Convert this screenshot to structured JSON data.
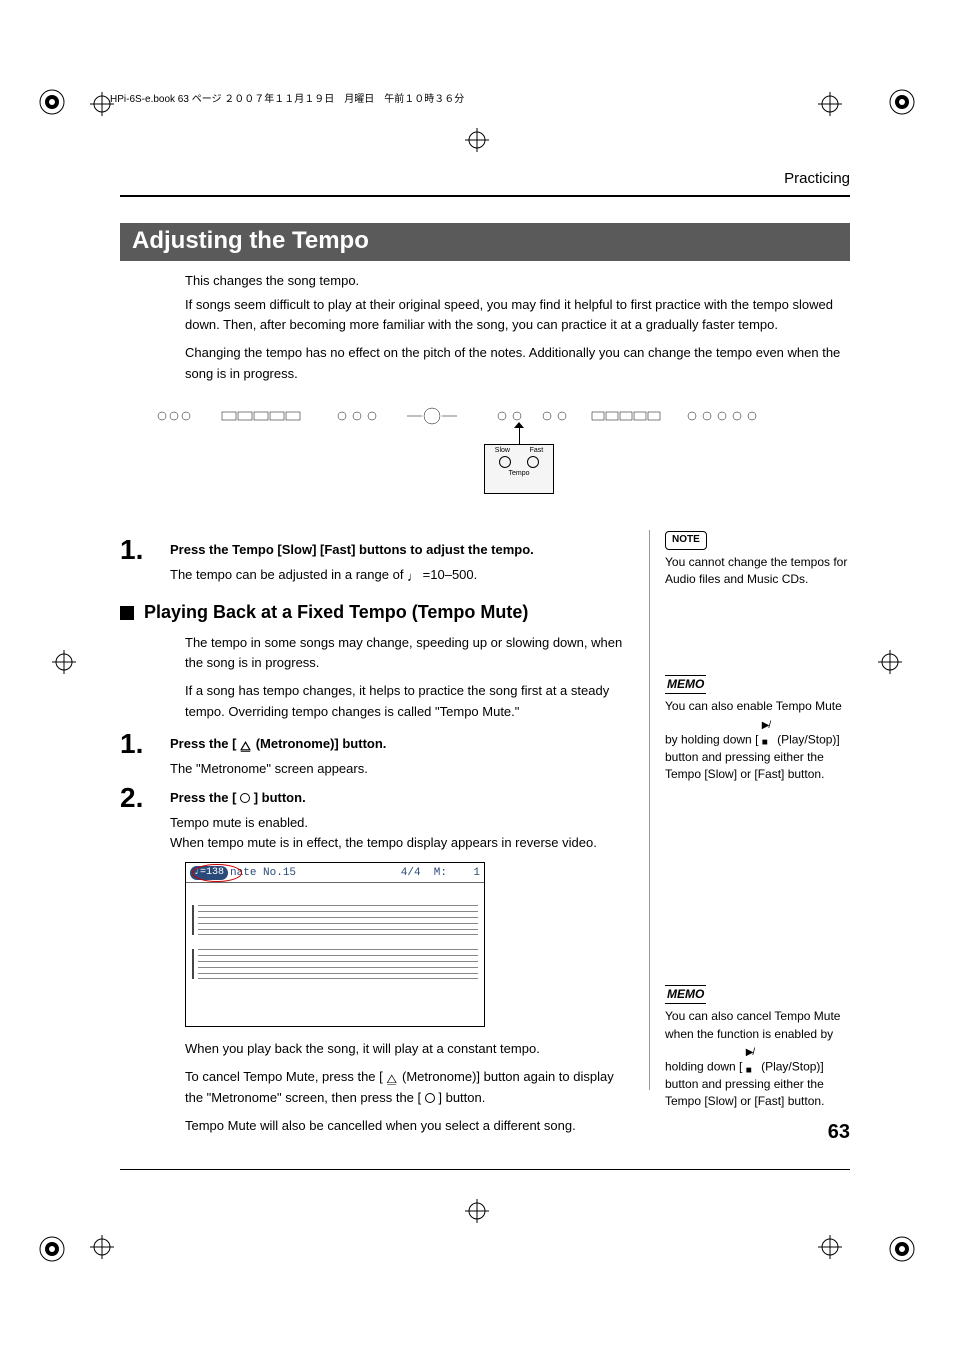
{
  "header_line": "HPi-6S-e.book  63 ページ  ２００７年１１月１９日　月曜日　午前１０時３６分",
  "section": "Practicing",
  "title": "Adjusting the Tempo",
  "intro": {
    "p1": "This changes the song tempo.",
    "p2": "If songs seem difficult to play at their original speed, you may find it helpful to first practice with the tempo slowed down. Then, after becoming more familiar with the song, you can practice it at a gradually faster tempo.",
    "p3": "Changing the tempo has no effect on the pitch of the notes. Additionally you can change the tempo even when the song is in progress."
  },
  "panel": {
    "callout_left": "Slow",
    "callout_right": "Fast",
    "callout_bottom": "Tempo"
  },
  "step1": {
    "num": "1.",
    "title": "Press the Tempo [Slow] [Fast] buttons to adjust the tempo.",
    "body_pre": "The tempo can be adjusted in a range of ",
    "body_post": " =10–500."
  },
  "sub_heading": "Playing Back at a Fixed Tempo (Tempo Mute)",
  "sub_intro": {
    "p1": "The tempo in some songs may change, speeding up or slowing down, when the song is in progress.",
    "p2": "If a song has tempo changes, it helps to practice the song first at a steady tempo. Overriding tempo changes is called \"Tempo Mute.\""
  },
  "sub_step1": {
    "num": "1.",
    "title_pre": "Press the [ ",
    "title_post": " (Metronome)] button.",
    "body": "The \"Metronome\" screen appears."
  },
  "sub_step2": {
    "num": "2.",
    "title_pre": "Press the [ ",
    "title_post": " ] button.",
    "body1": "Tempo mute is enabled.",
    "body2": "When tempo mute is in effect, the tempo display appears in reverse video."
  },
  "screen": {
    "tempo": "♩=138",
    "song": "nate No.15",
    "time_sig": "4/4",
    "measure_label": "M:",
    "measure": "1"
  },
  "after_screen": {
    "p1": "When you play back the song, it will play at a constant tempo.",
    "p2_pre": "To cancel Tempo Mute, press the [ ",
    "p2_mid": " (Metronome)] button again to display the \"Metronome\" screen, then press the [ ",
    "p2_post": " ] button.",
    "p3": "Tempo Mute will also be cancelled when you select a different song."
  },
  "note": {
    "badge": "NOTE",
    "text": "You cannot change the tempos for Audio files and Music CDs."
  },
  "memo1": {
    "badge": "MEMO",
    "text_pre": "You can also enable Tempo Mute by holding down [ ",
    "text_post": " (Play/Stop)] button and pressing either the Tempo [Slow] or [Fast] button."
  },
  "memo2": {
    "badge": "MEMO",
    "text_pre": "You can also cancel Tempo Mute when the function is enabled by holding down [ ",
    "text_post": " (Play/Stop)] button and pressing either the Tempo [Slow] or [Fast] button."
  },
  "page_number": "63"
}
